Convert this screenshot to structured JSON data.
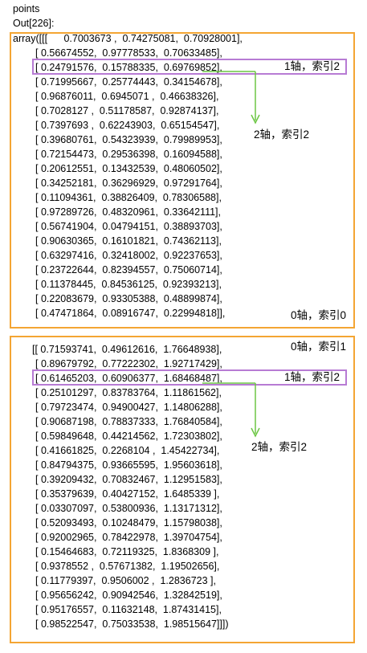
{
  "header": {
    "var_line": "points",
    "out_label": "Out[226]:"
  },
  "block0": {
    "prefix": "array([[[",
    "rows": [
      " 0.7003673 ,  0.74275081,  0.70928001],",
      "[ 0.56674552,  0.97778533,  0.70633485],",
      "[ 0.24791576,  0.15788335,  0.69769852],",
      "[ 0.71995667,  0.25774443,  0.34154678],",
      "[ 0.96876011,  0.6945071 ,  0.46638326],",
      "[ 0.7028127 ,  0.51178587,  0.92874137],",
      "[ 0.7397693 ,  0.62243903,  0.65154547],",
      "[ 0.39680761,  0.54323939,  0.79989953],",
      "[ 0.72154473,  0.29536398,  0.16094588],",
      "[ 0.20612551,  0.13432539,  0.48060502],",
      "[ 0.34252181,  0.36296929,  0.97291764],",
      "[ 0.11094361,  0.38826409,  0.78306588],",
      "[ 0.97289726,  0.48320961,  0.33642111],",
      "[ 0.56741904,  0.04794151,  0.38893703],",
      "[ 0.90630365,  0.16101821,  0.74362113],",
      "[ 0.63297416,  0.32418002,  0.92237653],",
      "[ 0.23722644,  0.82394557,  0.75060714],",
      "[ 0.11378445,  0.84536125,  0.92393213],",
      "[ 0.22083679,  0.93305388,  0.48899874],",
      "[ 0.47471864,  0.08916747,  0.22994818]],"
    ],
    "annot_axis1": "1轴，索引2",
    "annot_axis2": "2轴，索引2",
    "annot_axis0": "0轴，索引0"
  },
  "block1": {
    "rows": [
      "[[ 0.71593741,  0.49612616,  1.76648938],",
      "[ 0.89679792,  0.77222302,  1.92717429],",
      "[ 0.61465203,  0.60906377,  1.68468487],",
      "[ 0.25101297,  0.83783764,  1.11861562],",
      "[ 0.79723474,  0.94900427,  1.14806288],",
      "[ 0.90687198,  0.78837333,  1.76840584],",
      "[ 0.59849648,  0.44214562,  1.72303802],",
      "[ 0.41661825,  0.2268104 ,  1.45422734],",
      "[ 0.84794375,  0.93665595,  1.95603618],",
      "[ 0.39209432,  0.70832467,  1.12951583],",
      "[ 0.35379639,  0.40427152,  1.6485339 ],",
      "[ 0.03307097,  0.53800936,  1.13171312],",
      "[ 0.52093493,  0.10248479,  1.15798038],",
      "[ 0.92002965,  0.78422978,  1.39704754],",
      "[ 0.15464683,  0.72119325,  1.8368309 ],",
      "[ 0.9378552 ,  0.57671382,  1.19502656],",
      "[ 0.11779397,  0.9506002 ,  1.2836723 ],",
      "[ 0.95656242,  0.90942546,  1.32842519],",
      "[ 0.95176557,  0.11632148,  1.87431415],",
      "[ 0.98522547,  0.75033538,  1.98515647]]])"
    ],
    "annot_axis0": "0轴，索引1",
    "annot_axis1": "1轴，索引2",
    "annot_axis2": "2轴，索引2"
  },
  "colors": {
    "orange_box": "#f4a533",
    "purple_box": "#b77bd4",
    "green_arrow": "#6cc644"
  }
}
